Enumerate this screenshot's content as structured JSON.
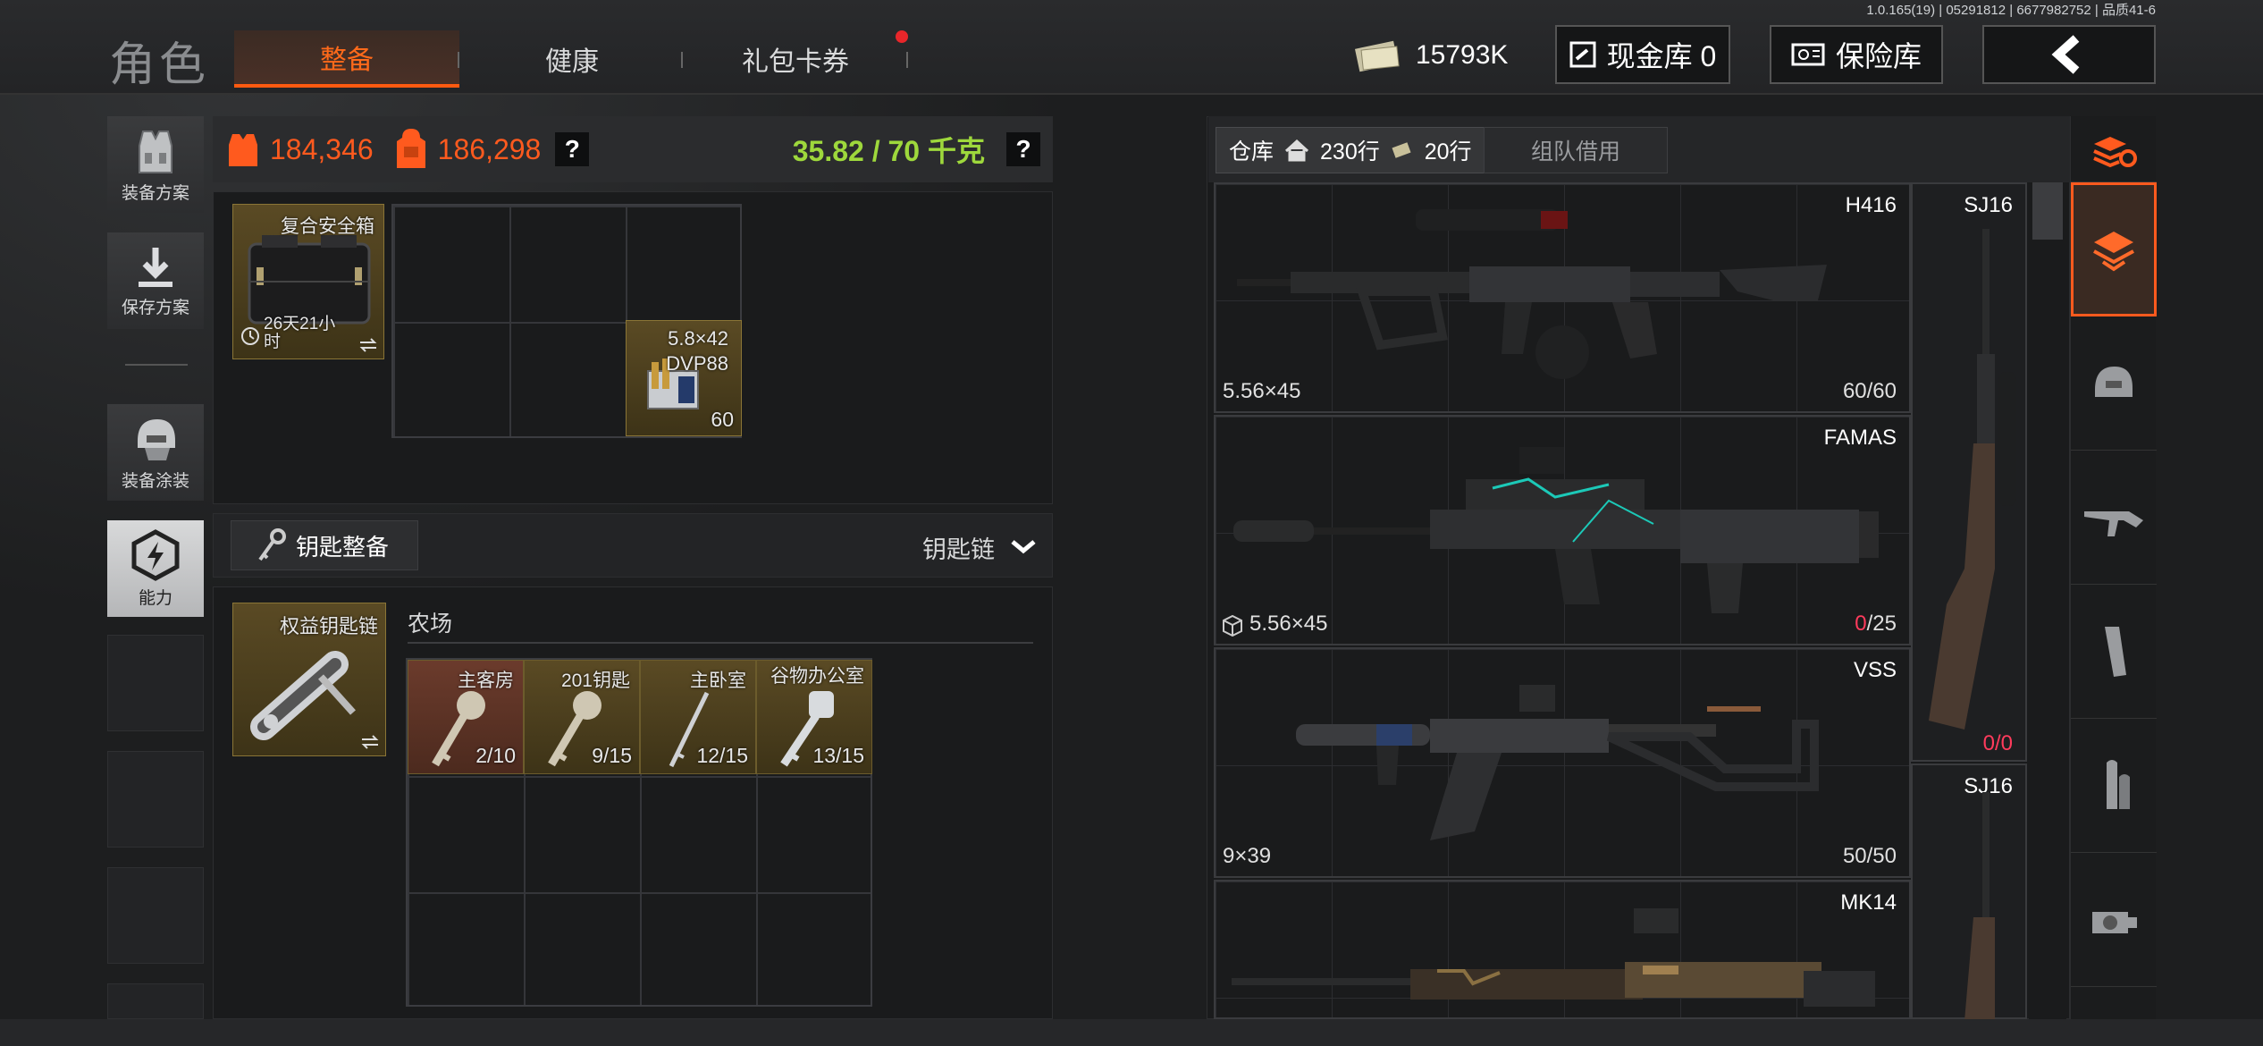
{
  "version": "1.0.165(19) | 05291812 | 6677982752 | 品质41-6",
  "header": {
    "title": "角色",
    "tabs": [
      {
        "label": "整备",
        "active": true
      },
      {
        "label": "健康",
        "active": false
      },
      {
        "label": "礼包卡券",
        "active": false
      }
    ],
    "currency": "15793K",
    "cash_vault": "现金库 0",
    "insurance": "保险库"
  },
  "sidebar": {
    "items": [
      {
        "label": "装备方案",
        "icon": "vest-icon"
      },
      {
        "label": "保存方案",
        "icon": "download-icon"
      },
      {
        "label": "装备涂装",
        "icon": "helmet-icon"
      },
      {
        "label": "能力",
        "icon": "ability-icon"
      }
    ]
  },
  "stats": {
    "armor_value": "184,346",
    "backpack_value": "186,298",
    "weight": "35.82 / 70 千克",
    "help": "?"
  },
  "safebox": {
    "name": "复合安全箱",
    "timer": "26天21小时",
    "ammo_name": "5.8×42 DVP88",
    "ammo_count": "60"
  },
  "keys": {
    "section_label": "钥匙整备",
    "dropdown_label": "钥匙链",
    "keychain_name": "权益钥匙链",
    "location": "农场",
    "items": [
      {
        "name": "主客房",
        "count": "2/10"
      },
      {
        "name": "201钥匙",
        "count": "9/15"
      },
      {
        "name": "主卧室",
        "count": "12/15"
      },
      {
        "name": "谷物办公室",
        "count": "13/15"
      }
    ]
  },
  "warehouse": {
    "label": "仓库",
    "rows_home": "230行",
    "rows_ticket": "20行",
    "team_borrow": "组队借用",
    "weapons": [
      {
        "name": "H416",
        "caliber": "5.56×45",
        "ammo": "60/60"
      },
      {
        "name": "FAMAS",
        "caliber": "5.56×45",
        "ammo_low": "0",
        "ammo_rest": "/25"
      },
      {
        "name": "VSS",
        "caliber": "9×39",
        "ammo": "50/50"
      },
      {
        "name": "MK14",
        "caliber": "",
        "ammo": ""
      }
    ],
    "side_weapons": [
      {
        "name": "SJ16",
        "ammo_low": "0",
        "ammo_rest": "/0"
      },
      {
        "name": "SJ16"
      }
    ]
  },
  "colors": {
    "accent": "#ff5a1e",
    "weight_ok": "#9ed83c",
    "warning": "#e8262a"
  }
}
